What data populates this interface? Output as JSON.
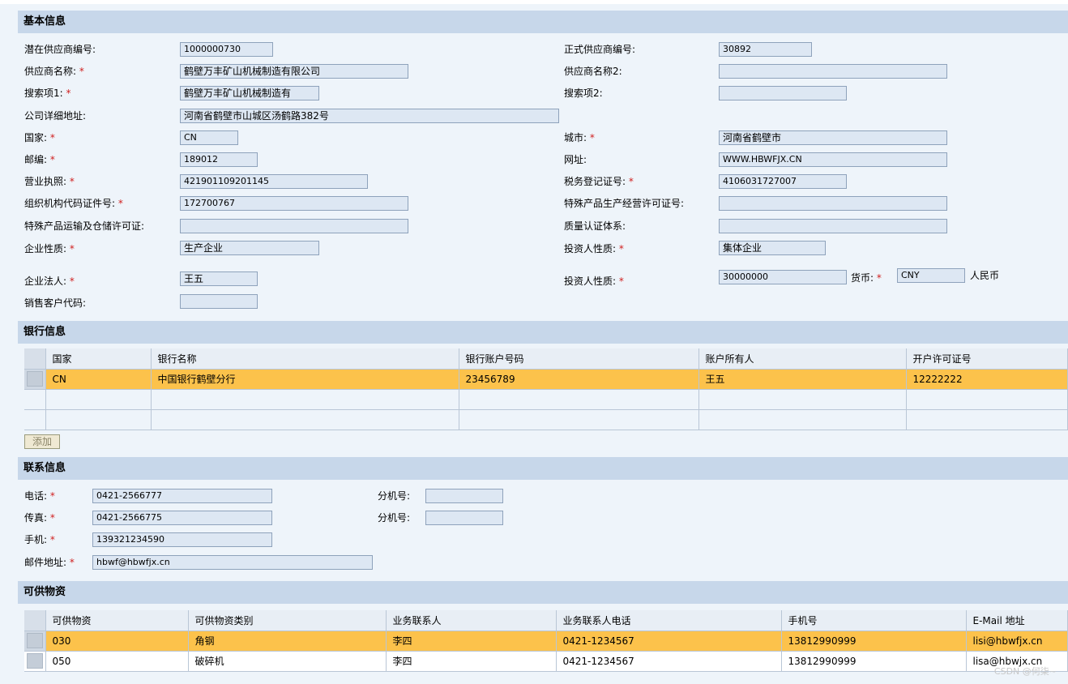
{
  "basic": {
    "title": "基本信息",
    "fields": {
      "potential_vendor_no": {
        "label": "潜在供应商编号:",
        "value": "1000000730"
      },
      "formal_vendor_no": {
        "label": "正式供应商编号:",
        "value": "30892"
      },
      "vendor_name": {
        "label": "供应商名称:",
        "value": "鹤壁万丰矿山机械制造有限公司"
      },
      "vendor_name2": {
        "label": "供应商名称2:",
        "value": ""
      },
      "search_term1": {
        "label": "搜索项1:",
        "value": "鹤壁万丰矿山机械制造有"
      },
      "search_term2": {
        "label": "搜索项2:",
        "value": ""
      },
      "address": {
        "label": "公司详细地址:",
        "value": "河南省鹤壁市山城区汤鹤路382号"
      },
      "country": {
        "label": "国家:",
        "value": "CN"
      },
      "city": {
        "label": "城市:",
        "value": "河南省鹤壁市"
      },
      "postcode": {
        "label": "邮编:",
        "value": "189012"
      },
      "website": {
        "label": "网址:",
        "value": "WWW.HBWFJX.CN"
      },
      "business_license": {
        "label": "营业执照:",
        "value": "421901109201145"
      },
      "tax_reg_no": {
        "label": "税务登记证号:",
        "value": "4106031727007"
      },
      "org_code": {
        "label": "组织机构代码证件号:",
        "value": "172700767"
      },
      "special_prod_license": {
        "label": "特殊产品生产经营许可证号:",
        "value": ""
      },
      "special_transport_license": {
        "label": "特殊产品运输及仓储许可证:",
        "value": ""
      },
      "quality_cert": {
        "label": "质量认证体系:",
        "value": ""
      },
      "enterprise_nature": {
        "label": "企业性质:",
        "value": "生产企业"
      },
      "investor_nature": {
        "label": "投资人性质:",
        "value": "集体企业"
      },
      "legal_person": {
        "label": "企业法人:",
        "value": "王五"
      },
      "investor_nature2": {
        "label": "投资人性质:",
        "value": "30000000"
      },
      "currency": {
        "label": "货币:",
        "value": "CNY",
        "text": "人民币"
      },
      "sales_customer_code": {
        "label": "销售客户代码:",
        "value": ""
      }
    },
    "required_mark": "*"
  },
  "bank": {
    "title": "银行信息",
    "columns": [
      "国家",
      "银行名称",
      "银行账户号码",
      "账户所有人",
      "开户许可证号"
    ],
    "rows": [
      [
        "CN",
        "中国银行鹤壁分行",
        "23456789",
        "王五",
        "12222222"
      ]
    ],
    "add_label": "添加"
  },
  "contact": {
    "title": "联系信息",
    "phone": {
      "label": "电话:",
      "value": "0421-2566777"
    },
    "phone_ext": {
      "label": "分机号:",
      "value": ""
    },
    "fax": {
      "label": "传真:",
      "value": "0421-2566775"
    },
    "fax_ext": {
      "label": "分机号:",
      "value": ""
    },
    "mobile": {
      "label": "手机:",
      "value": "139321234590"
    },
    "email": {
      "label": "邮件地址:",
      "value": "hbwf@hbwfjx.cn"
    }
  },
  "materials": {
    "title": "可供物资",
    "columns": [
      "可供物资",
      "可供物资类别",
      "业务联系人",
      "业务联系人电话",
      "手机号",
      "E-Mail 地址"
    ],
    "rows": [
      [
        "030",
        "角钢",
        "李四",
        "0421-1234567",
        "13812990999",
        "lisi@hbwfjx.cn"
      ],
      [
        "050",
        "破碎机",
        "李四",
        "0421-1234567",
        "13812990999",
        "lisa@hbwjx.cn"
      ]
    ]
  },
  "watermark": "CSDN @何柒~"
}
